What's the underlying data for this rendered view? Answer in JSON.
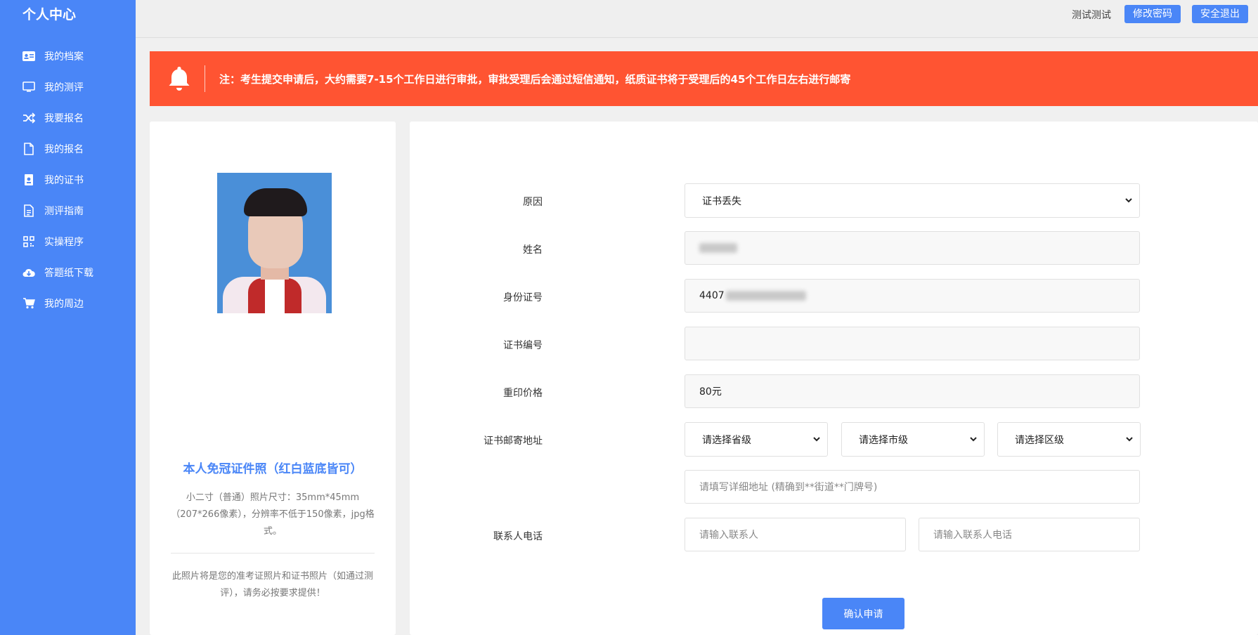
{
  "sidebar": {
    "title": "个人中心",
    "items": [
      {
        "label": "我的档案",
        "icon": "id-card-icon"
      },
      {
        "label": "我的测评",
        "icon": "monitor-icon"
      },
      {
        "label": "我要报名",
        "icon": "shuffle-icon"
      },
      {
        "label": "我的报名",
        "icon": "document-icon"
      },
      {
        "label": "我的证书",
        "icon": "certificate-icon"
      },
      {
        "label": "测评指南",
        "icon": "guide-icon"
      },
      {
        "label": "实操程序",
        "icon": "qrcode-icon"
      },
      {
        "label": "答题纸下载",
        "icon": "cloud-download-icon"
      },
      {
        "label": "我的周边",
        "icon": "cart-icon"
      }
    ]
  },
  "header": {
    "username": "测试测试",
    "change_password": "修改密码",
    "logout": "安全退出"
  },
  "notice": {
    "text": "注：考生提交申请后，大约需要7-15个工作日进行审批，审批受理后会通过短信通知，纸质证书将于受理后的45个工作日左右进行邮寄",
    "color": "#ff5432"
  },
  "photo_panel": {
    "title": "本人免冠证件照（红白蓝底皆可）",
    "desc": "小二寸（普通）照片尺寸：35mm*45mm（207*266像素），分辨率不低于150像素，jpg格式。",
    "note": "此照片将是您的准考证照片和证书照片（如通过测评），请务必按要求提供！"
  },
  "form": {
    "reason_label": "原因",
    "reason_value": "证书丢失",
    "name_label": "姓名",
    "id_label": "身份证号",
    "id_prefix": "4407",
    "cert_no_label": "证书编号",
    "cert_no_value": "",
    "price_label": "重印价格",
    "price_value": "80元",
    "address_label": "证书邮寄地址",
    "province_placeholder": "请选择省级",
    "city_placeholder": "请选择市级",
    "district_placeholder": "请选择区级",
    "detail_address_placeholder": "请填写详细地址 (精确到**街道**门牌号)",
    "contact_label": "联系人电话",
    "contact_name_placeholder": "请输入联系人",
    "contact_phone_placeholder": "请输入联系人电话",
    "submit": "确认申请"
  },
  "colors": {
    "primary": "#4a86f7",
    "alert": "#ff5432"
  }
}
